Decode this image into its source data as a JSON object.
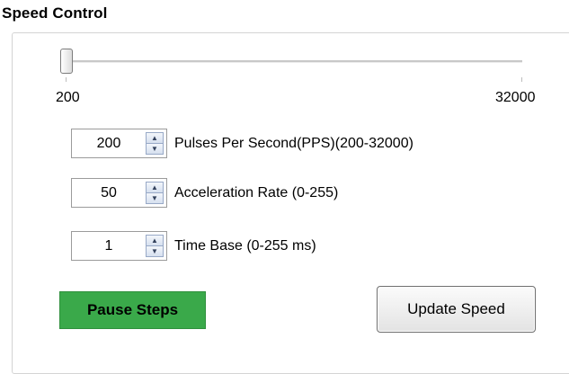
{
  "group": {
    "title": "Speed Control"
  },
  "slider": {
    "min_label": "200",
    "max_label": "32000",
    "min": 200,
    "max": 32000,
    "value": 200
  },
  "fields": [
    {
      "value": "200",
      "label": "Pulses Per Second(PPS)(200-32000)"
    },
    {
      "value": "50",
      "label": "Acceleration Rate (0-255)"
    },
    {
      "value": "1",
      "label": "Time Base (0-255 ms)"
    }
  ],
  "icons": {
    "spin_up": "spin-up-arrow-icon",
    "spin_down": "spin-down-arrow-icon"
  },
  "buttons": {
    "pause_label": "Pause Steps",
    "update_label": "Update Speed"
  },
  "colors": {
    "pause_bg": "#3aa94a"
  }
}
